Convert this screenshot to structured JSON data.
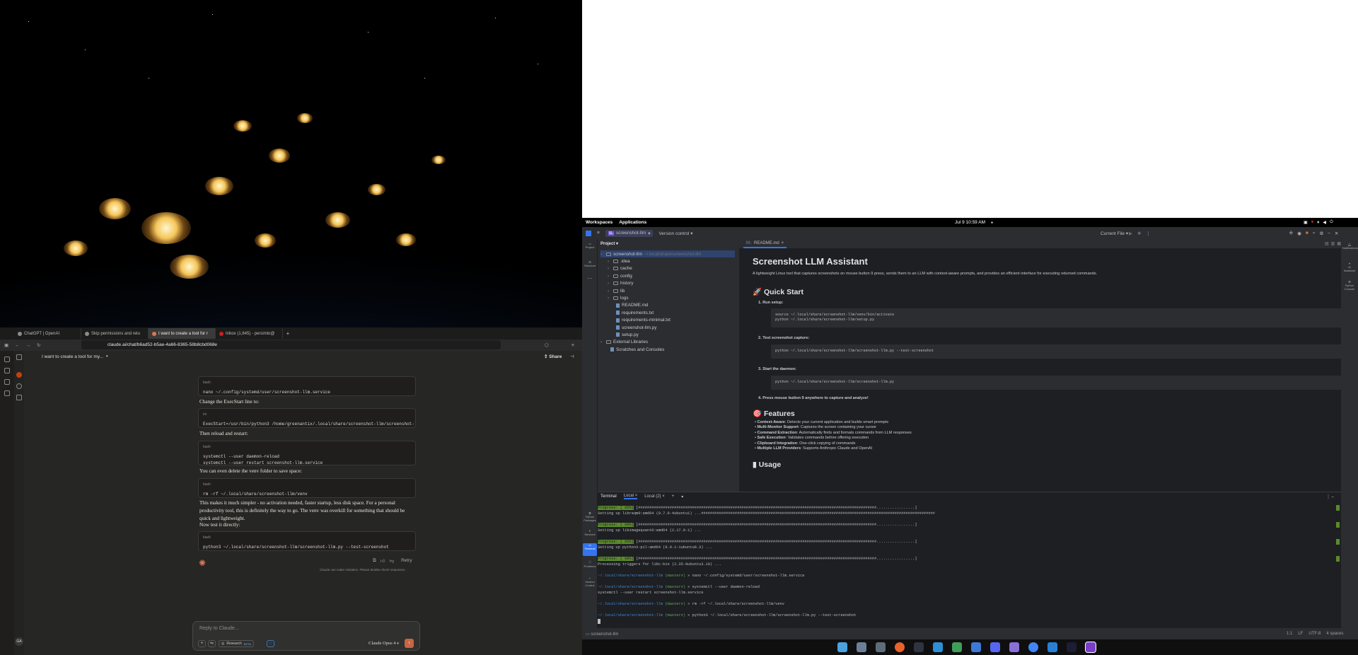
{
  "browser": {
    "tabs": [
      {
        "label": "ChatGPT | OpenAI"
      },
      {
        "label": "Skip permissions and retu"
      },
      {
        "label": "I want to create a tool for r"
      },
      {
        "label": "Inbox (1,645) - persimlo@"
      }
    ],
    "url": "claude.ai/chat/b6ad52-b5ae-4a66-8365-58b8cbd068e",
    "conversation_title": "I want to create a tool for my...",
    "share_label": "Share",
    "messages": [
      {
        "lang": "bash",
        "code": "nano ~/.config/systemd/user/screenshot-llm.service"
      },
      {
        "text": "Change the ExecStart line to:"
      },
      {
        "lang": "ini",
        "code": "ExecStart=/usr/bin/python3 /home/greenantix/.local/share/screenshot-llm/screenshot-l"
      },
      {
        "text": "Then reload and restart:"
      },
      {
        "lang": "bash",
        "code": "systemctl --user daemon-reload\nsystemctl --user restart screenshot-llm.service"
      },
      {
        "text": "You can even delete the venv folder to save space:"
      },
      {
        "lang": "bash",
        "code": "rm -rf ~/.local/share/screenshot-llm/venv"
      },
      {
        "text": "This makes it much simpler - no activation needed, faster startup, less disk space. For a personal productivity tool, this is definitely the way to go. The venv was overkill for something that should be quick and lightweight."
      },
      {
        "text": "Now test it directly:"
      },
      {
        "lang": "bash",
        "code": "python3 ~/.local/share/screenshot-llm/screenshot-llm.py --test-screenshot"
      }
    ],
    "retry_label": "Retry",
    "disclaimer": "Claude can make mistakes. Please double-check responses.",
    "input_placeholder": "Reply to Claude...",
    "research_label": "Research",
    "research_badge": "BETA",
    "model_label": "Claude Opus 4",
    "avatar_initials": "GA"
  },
  "system": {
    "workspaces": "Workspaces",
    "applications": "Applications",
    "clock": "Jul 9  10:59 AM"
  },
  "ide": {
    "project_name": "screenshot-llm",
    "vcs": "Version control",
    "run_config": "Current File",
    "project_label": "Project",
    "tree": [
      {
        "name": "screenshot-llm",
        "hint": "~/.local/share/screenshot-llm",
        "type": "root"
      },
      {
        "name": ".idea",
        "type": "folder"
      },
      {
        "name": "cache",
        "type": "folder"
      },
      {
        "name": "config",
        "type": "folder"
      },
      {
        "name": "history",
        "type": "folder"
      },
      {
        "name": "lib",
        "type": "folder"
      },
      {
        "name": "logs",
        "type": "folder"
      },
      {
        "name": "README.md",
        "type": "file"
      },
      {
        "name": "requirements.txt",
        "type": "file"
      },
      {
        "name": "requirements-minimal.txt",
        "type": "file"
      },
      {
        "name": "screenshot-llm.py",
        "type": "file"
      },
      {
        "name": "setup.py",
        "type": "file"
      },
      {
        "name": "External Libraries",
        "type": "folder"
      },
      {
        "name": "Scratches and Consoles",
        "type": "file"
      }
    ],
    "editor_tab": "README.md",
    "readme": {
      "title": "Screenshot LLM Assistant",
      "intro": "A lightweight Linux tool that captures screenshots on mouse button 9 press, sends them to an LLM with context-aware prompts, and provides an efficient interface for executing returned commands.",
      "quick_start": "🚀 Quick Start",
      "step1": "1. Run setup:",
      "code1": "source ~/.local/share/screenshot-llm/venv/bin/activate\npython ~/.local/share/screenshot-llm/setup.py",
      "step2": "2. Test screenshot capture:",
      "code2": "python ~/.local/share/screenshot-llm/screenshot-llm.py --test-screenshot",
      "step3": "3. Start the daemon:",
      "code3": "python ~/.local/share/screenshot-llm/screenshot-llm.py",
      "step4": "4. Press mouse button 9 anywhere to capture and analyze!",
      "features": "🎯 Features",
      "feature_items": [
        {
          "name": "Context-Aware",
          "desc": ": Detects your current application and builds smart prompts"
        },
        {
          "name": "Multi-Monitor Support",
          "desc": ": Captures the screen containing your cursor"
        },
        {
          "name": "Command Extraction",
          "desc": ": Automatically finds and formats commands from LLM responses"
        },
        {
          "name": "Safe Execution",
          "desc": ": Validates commands before offering execution"
        },
        {
          "name": "Clipboard Integration",
          "desc": ": One-click copying of commands"
        },
        {
          "name": "Multiple LLM Providers",
          "desc": ": Supports Anthropic Claude and OpenAI"
        }
      ],
      "usage": "Usage"
    },
    "terminal": {
      "label": "Terminal",
      "tabs": [
        "Local",
        "Local (2)"
      ],
      "lines": [
        {
          "kind": "progress",
          "tag": "Progress: [ 85%]"
        },
        {
          "kind": "text",
          "text": "Setting up libraqm0:amd64 (0.7.0-4ubuntu1) ...########################################################################################################"
        },
        {
          "kind": "progress",
          "tag": "Progress: [ 90%]"
        },
        {
          "kind": "text",
          "text": "Setting up libimagequant0:amd64 (2.17.0-1) ..."
        },
        {
          "kind": "progress",
          "tag": "Progress: [ 95%]"
        },
        {
          "kind": "text",
          "text": "Setting up python3-pil:amd64 (9.0.1-1ubuntu0.3) ..."
        },
        {
          "kind": "progress",
          "tag": "Progress: [ 98%]"
        },
        {
          "kind": "text",
          "text": "Processing triggers for libc-bin (2.35-0ubuntu3.10) ..."
        },
        {
          "kind": "prompt",
          "path": "~/.local/share/screenshot-llm",
          "branch": "(master✗)",
          "cmd": "nano ~/.config/systemd/user/screenshot-llm.service"
        },
        {
          "kind": "prompt",
          "path": "~/.local/share/screenshot-llm",
          "branch": "(master✗)",
          "cmd": "systemctl --user daemon-reload"
        },
        {
          "kind": "text",
          "text": "systemctl --user restart screenshot-llm.service"
        },
        {
          "kind": "prompt",
          "path": "~/.local/share/screenshot-llm",
          "branch": "(master✗)",
          "cmd": "rm -rf ~/.local/share/screenshot-llm/venv"
        },
        {
          "kind": "prompt",
          "path": "~/.local/share/screenshot-llm",
          "branch": "(master✗)",
          "cmd": "python3 ~/.local/share/screenshot-llm/screenshot-llm.py --test-screenshot"
        }
      ]
    },
    "status": {
      "breadcrumb": "screenshot-llm",
      "position": "1:1",
      "line_ending": "LF",
      "encoding": "UTF-8",
      "indent": "4 spaces"
    }
  }
}
